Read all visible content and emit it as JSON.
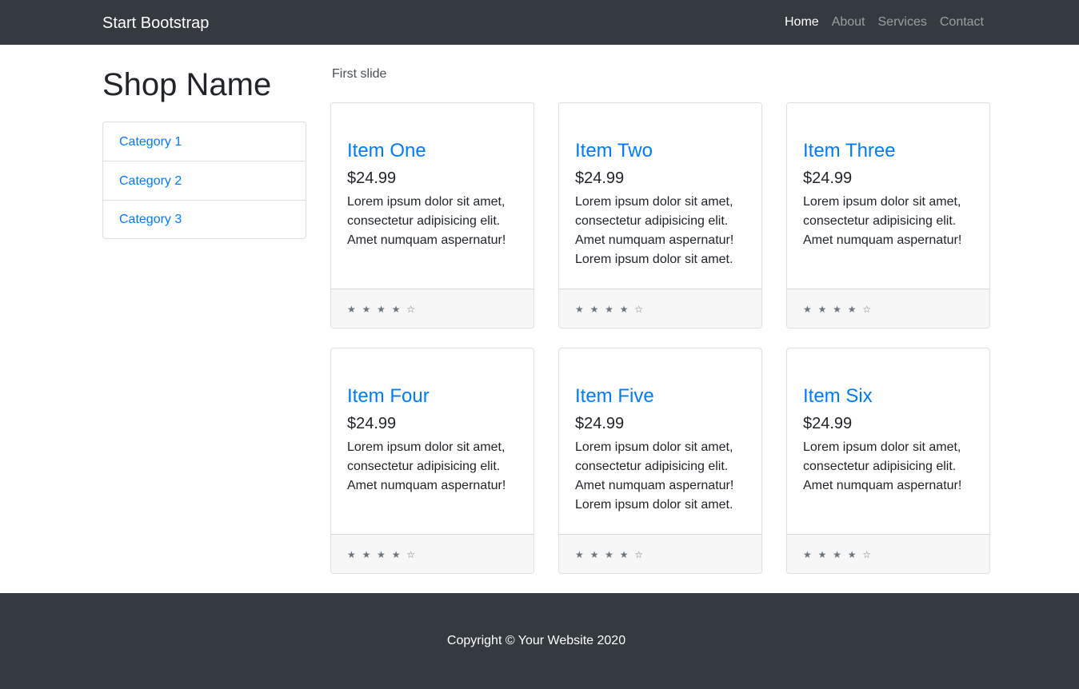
{
  "navbar": {
    "brand": "Start Bootstrap",
    "links": [
      {
        "label": "Home"
      },
      {
        "label": "About"
      },
      {
        "label": "Services"
      },
      {
        "label": "Contact"
      }
    ]
  },
  "sidebar": {
    "title": "Shop Name",
    "categories": [
      {
        "label": "Category 1"
      },
      {
        "label": "Category 2"
      },
      {
        "label": "Category 3"
      }
    ]
  },
  "carousel": {
    "alt": "First slide"
  },
  "products": [
    {
      "title": "Item One",
      "price": "$24.99",
      "description": "Lorem ipsum dolor sit amet, consectetur adipisicing elit. Amet numquam aspernatur!",
      "rating": "★ ★ ★ ★ ☆"
    },
    {
      "title": "Item Two",
      "price": "$24.99",
      "description": "Lorem ipsum dolor sit amet, consectetur adipisicing elit. Amet numquam aspernatur! Lorem ipsum dolor sit amet.",
      "rating": "★ ★ ★ ★ ☆"
    },
    {
      "title": "Item Three",
      "price": "$24.99",
      "description": "Lorem ipsum dolor sit amet, consectetur adipisicing elit. Amet numquam aspernatur!",
      "rating": "★ ★ ★ ★ ☆"
    },
    {
      "title": "Item Four",
      "price": "$24.99",
      "description": "Lorem ipsum dolor sit amet, consectetur adipisicing elit. Amet numquam aspernatur!",
      "rating": "★ ★ ★ ★ ☆"
    },
    {
      "title": "Item Five",
      "price": "$24.99",
      "description": "Lorem ipsum dolor sit amet, consectetur adipisicing elit. Amet numquam aspernatur! Lorem ipsum dolor sit amet.",
      "rating": "★ ★ ★ ★ ☆"
    },
    {
      "title": "Item Six",
      "price": "$24.99",
      "description": "Lorem ipsum dolor sit amet, consectetur adipisicing elit. Amet numquam aspernatur!",
      "rating": "★ ★ ★ ★ ☆"
    }
  ],
  "footer": {
    "copyright": "Copyright © Your Website 2020"
  },
  "colors": {
    "navbar_bg": "#343a40",
    "link": "#007bff",
    "footer_bg": "#343a40"
  }
}
